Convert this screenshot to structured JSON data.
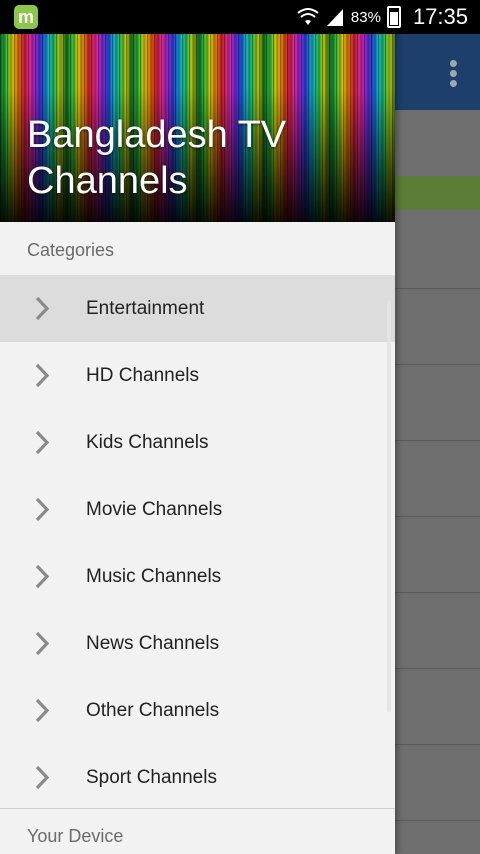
{
  "status_bar": {
    "app_icon": "m",
    "battery_percent": "83%",
    "time": "17:35"
  },
  "drawer": {
    "title": "Bangladesh TV Channels",
    "sections": {
      "categories_label": "Categories",
      "device_label": "Your Device"
    },
    "items": [
      {
        "label": "Entertainment",
        "icon": "chevron-right-icon",
        "active": true
      },
      {
        "label": "HD Channels",
        "icon": "chevron-right-icon",
        "active": false
      },
      {
        "label": "Kids Channels",
        "icon": "chevron-right-icon",
        "active": false
      },
      {
        "label": "Movie Channels",
        "icon": "chevron-right-icon",
        "active": false
      },
      {
        "label": "Music Channels",
        "icon": "chevron-right-icon",
        "active": false
      },
      {
        "label": "News Channels",
        "icon": "chevron-right-icon",
        "active": false
      },
      {
        "label": "Other Channels",
        "icon": "chevron-right-icon",
        "active": false
      },
      {
        "label": "Sport Channels",
        "icon": "chevron-right-icon",
        "active": false
      }
    ]
  },
  "colors": {
    "toolbar": "#1e3f6c",
    "active_item": "#dcdcdc",
    "drawer_bg": "#f2f2f2"
  }
}
